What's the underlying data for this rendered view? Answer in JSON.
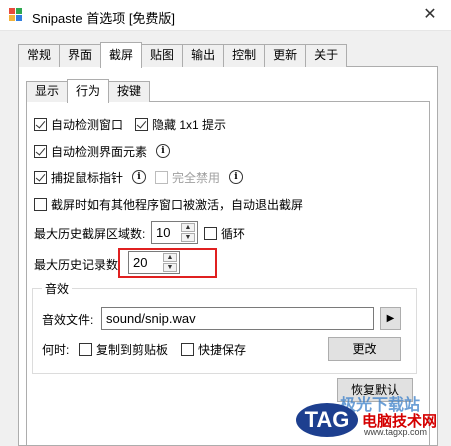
{
  "window": {
    "title": "Snipaste 首选项 [免费版]",
    "close_glyph": "✕",
    "icon_colors": [
      "#e84a3c",
      "#2ea84f",
      "#f2b33b",
      "#2f7de0"
    ]
  },
  "main_tabs": [
    {
      "label": "常规",
      "active": false
    },
    {
      "label": "界面",
      "active": false
    },
    {
      "label": "截屏",
      "active": true
    },
    {
      "label": "贴图",
      "active": false
    },
    {
      "label": "输出",
      "active": false
    },
    {
      "label": "控制",
      "active": false
    },
    {
      "label": "更新",
      "active": false
    },
    {
      "label": "关于",
      "active": false
    }
  ],
  "sub_tabs": [
    {
      "label": "显示",
      "active": false
    },
    {
      "label": "行为",
      "active": true
    },
    {
      "label": "按键",
      "active": false
    }
  ],
  "options": {
    "auto_detect_window": {
      "label": "自动检测窗口",
      "checked": true
    },
    "hide_1x1_hint": {
      "label": "隐藏 1x1 提示",
      "checked": true
    },
    "auto_detect_elements": {
      "label": "自动检测界面元素",
      "checked": true
    },
    "capture_cursor": {
      "label": "捕捉鼠标指针",
      "checked": true
    },
    "fully_disable": {
      "label": "完全禁用",
      "checked": false,
      "disabled": true
    },
    "auto_exit": {
      "label": "截屏时如有其他程序窗口被激活，自动退出截屏",
      "checked": false
    }
  },
  "history_regions": {
    "label": "最大历史截屏区域数:",
    "value": "10",
    "loop_label": "循环",
    "loop_checked": false
  },
  "history_records": {
    "label": "最大历史记录数",
    "value": "20"
  },
  "sound": {
    "group_title": "音效",
    "file_label": "音效文件:",
    "file_value": "sound/snip.wav",
    "play_glyph": "▶",
    "when_label": "何时:",
    "copy_label": "复制到剪贴板",
    "copy_checked": false,
    "quicksave_label": "快捷保存",
    "quicksave_checked": false,
    "change_label": "更改"
  },
  "restore_label": "恢复默认",
  "spin_up": "▲",
  "spin_down": "▼",
  "info_glyph": "i",
  "watermark": {
    "logo": "TAG",
    "top_text": "极光下载站",
    "cn_text": "电脑技术网",
    "url": "www.tagxp.com"
  }
}
